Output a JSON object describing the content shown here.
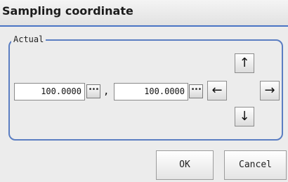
{
  "dialog": {
    "title": "Sampling coordinate"
  },
  "group": {
    "legend": "Actual"
  },
  "coords": {
    "x_value": "100.0000",
    "y_value": "100.0000",
    "separator": ","
  },
  "icons": {
    "more": "ellipsis-icon",
    "up": "arrow-up-icon",
    "down": "arrow-down-icon",
    "left": "arrow-left-icon",
    "right": "arrow-right-icon"
  },
  "buttons": {
    "ok": "OK",
    "cancel": "Cancel"
  }
}
